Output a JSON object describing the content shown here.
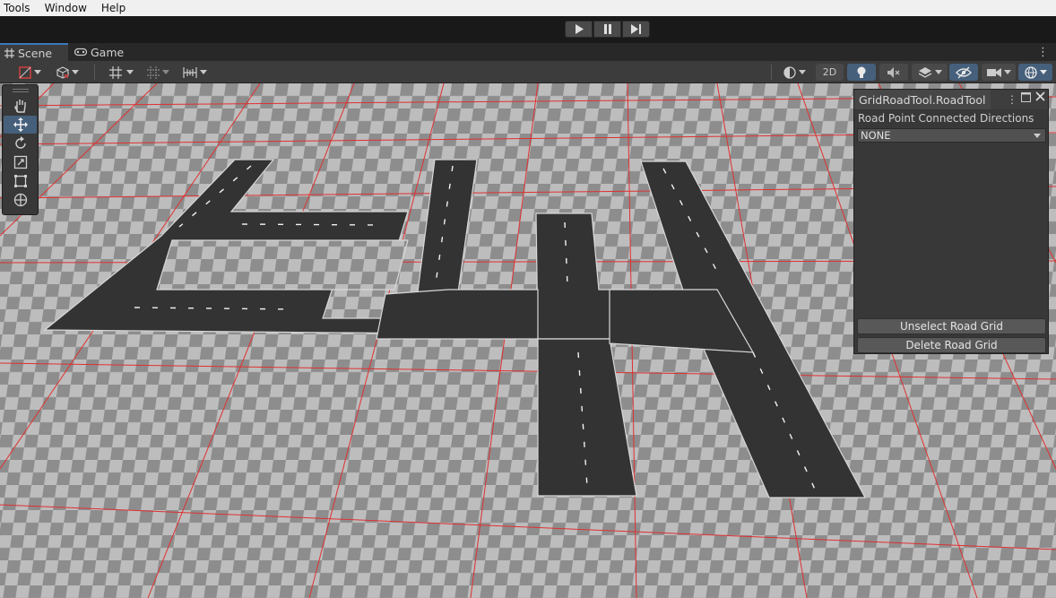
{
  "menu": {
    "items": [
      "Tools",
      "Window",
      "Help"
    ]
  },
  "playbar": {
    "play": "play-icon",
    "pause": "pause-icon",
    "step": "step-icon"
  },
  "tabs": {
    "scene": "Scene",
    "game": "Game"
  },
  "scene_toolbar": {
    "mode_2d": "2D"
  },
  "panel": {
    "title": "GridRoadTool.RoadTool",
    "label": "Road Point Connected Directions",
    "select_value": "NONE",
    "unselect_button": "Unselect Road Grid",
    "delete_button": "Delete Road Grid"
  },
  "colors": {
    "accent": "#3a79bb",
    "active_tool": "#46607c",
    "grid_line": "#e03030",
    "road": "#333333"
  }
}
